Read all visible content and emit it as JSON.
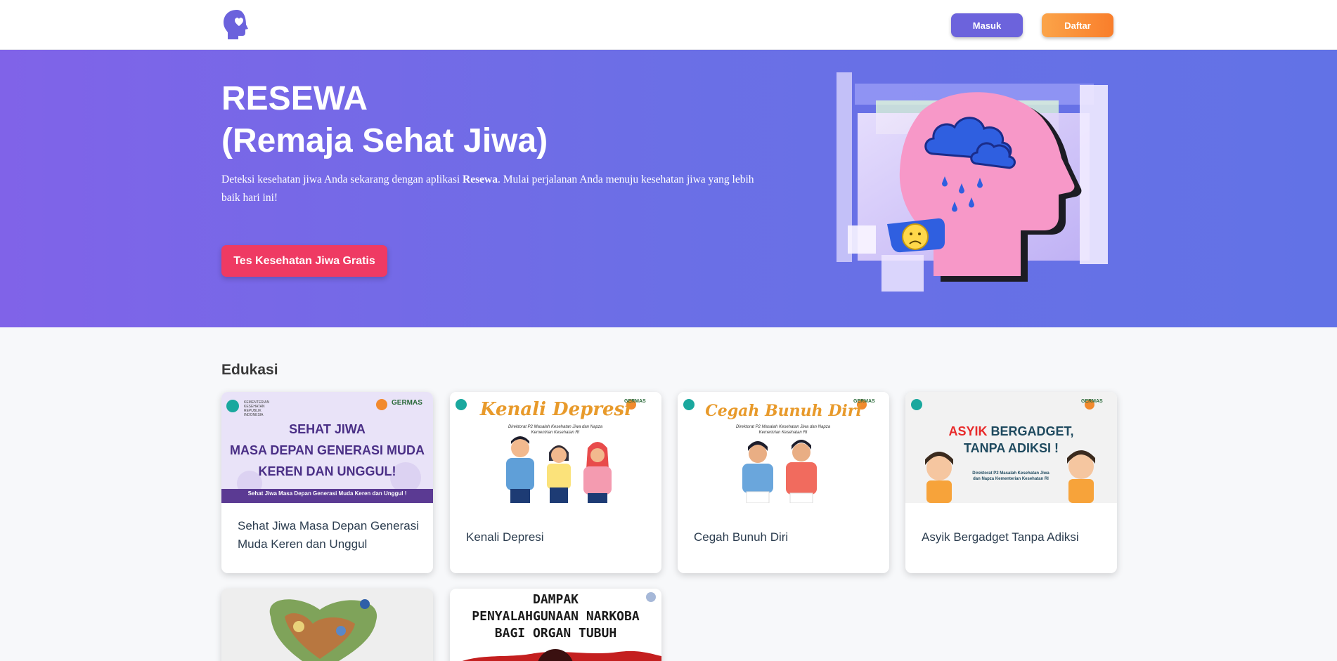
{
  "navbar": {
    "logo_icon": "head-heart-icon",
    "login_label": "Masuk",
    "register_label": "Daftar",
    "colors": {
      "login": "#6c63dc",
      "register": "#f98f36"
    }
  },
  "hero": {
    "title_line1": "RESEWA",
    "title_line2": "(Remaja Sehat Jiwa)",
    "desc_before": "Deteksi kesehatan jiwa Anda sekarang dengan aplikasi ",
    "desc_brand": "Resewa",
    "desc_after": ". Mulai perjalanan Anda menuju kesehatan jiwa yang lebih baik hari ini!",
    "cta_label": "Tes Kesehatan Jiwa Gratis",
    "illustration_icon": "sad-head-raincloud-illustration",
    "colors": {
      "cta": "#ef3a63",
      "gradient_start": "#8063e8",
      "gradient_end": "#6272e6"
    }
  },
  "edukasi": {
    "title": "Edukasi",
    "cards": [
      {
        "title": "Sehat Jiwa Masa Depan Generasi Muda Keren dan Unggul",
        "poster_lines": [
          "SEHAT JIWA",
          "MASA DEPAN GENERASI MUDA",
          "KEREN DAN UNGGUL!"
        ],
        "poster_caption": "Sehat Jiwa Masa Depan Generasi Muda Keren dan Unggul !"
      },
      {
        "title": "Kenali Depresi",
        "poster_heading": "Kenali Depresi",
        "poster_sub": "Direktorat P2 Masalah Kesehatan Jiwa dan Napza Kementrian Kesehatan RI"
      },
      {
        "title": "Cegah Bunuh Diri",
        "poster_heading": "Cegah Bunuh Diri",
        "poster_sub": "Direktorat P2 Masalah Kesehatan Jiwa dan Napza Kementrian Kesehatan RI"
      },
      {
        "title": "Asyik Bergadget Tanpa Adiksi",
        "poster_red": "ASYIK",
        "poster_rest": " BERGADGET,",
        "poster_line2": "TANPA ADIKSI !",
        "poster_sub": "Direktorat P2 Masalah Kesehatan Jiwa dan Napza Kementerian Kesehatan RI"
      }
    ],
    "row2": [
      {
        "title": ""
      },
      {
        "poster_line1": "DAMPAK",
        "poster_line2": "PENYALAHGUNAAN NARKOBA",
        "poster_line3": "BAGI ORGAN TUBUH"
      }
    ],
    "badge_text": "GERMAS"
  }
}
